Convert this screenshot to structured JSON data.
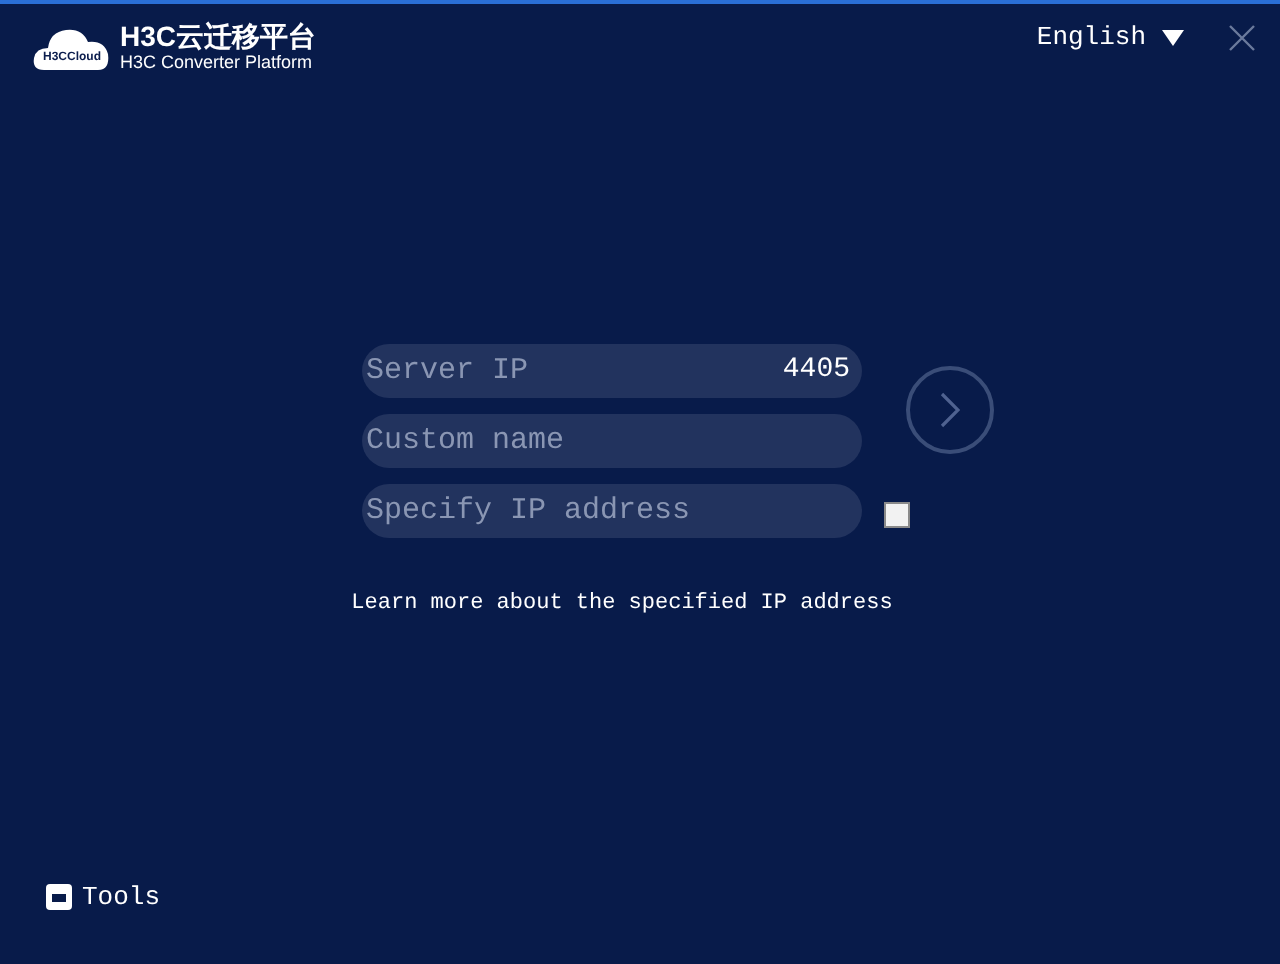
{
  "header": {
    "logo_text": "H3CCloud",
    "title": "H3C云迁移平台",
    "subtitle": "H3C Converter Platform",
    "language": "English"
  },
  "form": {
    "server_ip": {
      "placeholder": "Server IP",
      "port": "4405"
    },
    "custom_name": {
      "placeholder": "Custom name"
    },
    "specify_ip": {
      "placeholder": "Specify IP address",
      "checked": false
    },
    "link": "Learn more about the specified IP address"
  },
  "footer": {
    "tools": "Tools"
  }
}
